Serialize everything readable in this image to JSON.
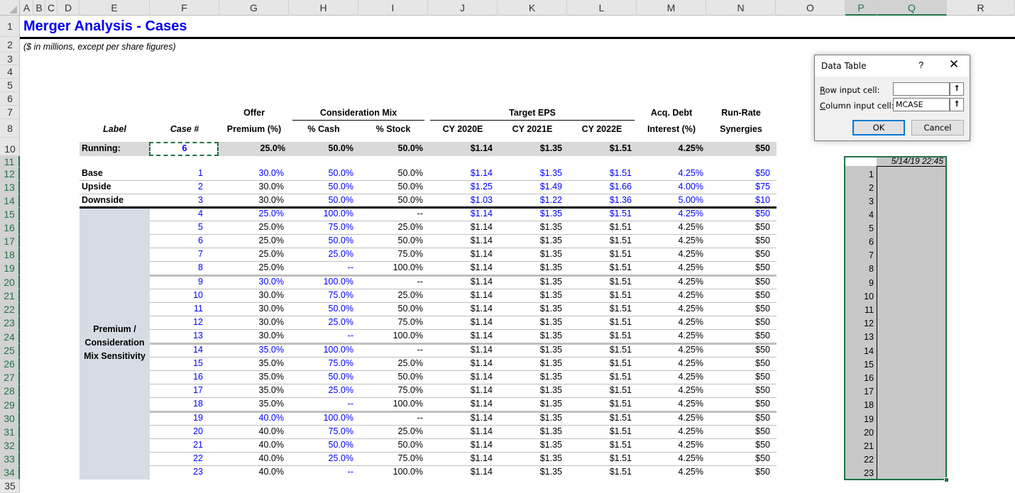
{
  "sheet": {
    "column_headers": [
      "A",
      "B",
      "C",
      "D",
      "E",
      "F",
      "G",
      "H",
      "I",
      "J",
      "K",
      "L",
      "M",
      "N",
      "O",
      "P",
      "Q",
      "R"
    ],
    "row_headers": [
      "1",
      "2",
      "3",
      "4",
      "5",
      "6",
      "7",
      "8",
      "10",
      "11",
      "12",
      "13",
      "14",
      "15",
      "16",
      "17",
      "18",
      "19",
      "20",
      "21",
      "22",
      "23",
      "24",
      "25",
      "26",
      "27",
      "28",
      "29",
      "30",
      "31",
      "32",
      "33",
      "34",
      "35"
    ],
    "title": "Merger Analysis - Cases",
    "subtitle": "($ in millions, except per share figures)"
  },
  "headers": {
    "label": "Label",
    "case": "Case #",
    "offer_top": "Offer",
    "offer_bottom": "Premium (%)",
    "consideration_group": "Consideration Mix",
    "cash": "% Cash",
    "stock": "% Stock",
    "eps_group": "Target EPS",
    "cy2020": "CY 2020E",
    "cy2021": "CY 2021E",
    "cy2022": "CY 2022E",
    "debt_top": "Acq. Debt",
    "debt_bottom": "Interest (%)",
    "syn_top": "Run-Rate",
    "syn_bottom": "Synergies"
  },
  "running": {
    "label": "Running:",
    "case": "6",
    "premium": "25.0%",
    "cash": "50.0%",
    "stock": "50.0%",
    "eps2020": "$1.14",
    "eps2021": "$1.35",
    "eps2022": "$1.51",
    "debt": "4.25%",
    "synergies": "$50"
  },
  "sensitivity_label": [
    "Premium /",
    "Consideration",
    "Mix Sensitivity"
  ],
  "cases": [
    {
      "label": "Base",
      "case": "1",
      "premium": "30.0%",
      "cash": "50.0%",
      "stock": "50.0%",
      "eps2020": "$1.14",
      "eps2021": "$1.35",
      "eps2022": "$1.51",
      "debt": "4.25%",
      "synergies": "$50"
    },
    {
      "label": "Upside",
      "case": "2",
      "premium": "30.0%",
      "cash": "50.0%",
      "stock": "50.0%",
      "eps2020": "$1.25",
      "eps2021": "$1.49",
      "eps2022": "$1.66",
      "debt": "4.00%",
      "synergies": "$75"
    },
    {
      "label": "Downside",
      "case": "3",
      "premium": "30.0%",
      "cash": "50.0%",
      "stock": "50.0%",
      "eps2020": "$1.03",
      "eps2021": "$1.22",
      "eps2022": "$1.36",
      "debt": "5.00%",
      "synergies": "$10"
    },
    {
      "label": "",
      "case": "4",
      "premium": "25.0%",
      "cash": "100.0%",
      "stock": "--",
      "eps2020": "$1.14",
      "eps2021": "$1.35",
      "eps2022": "$1.51",
      "debt": "4.25%",
      "synergies": "$50"
    },
    {
      "label": "",
      "case": "5",
      "premium": "25.0%",
      "cash": "75.0%",
      "stock": "25.0%",
      "eps2020": "$1.14",
      "eps2021": "$1.35",
      "eps2022": "$1.51",
      "debt": "4.25%",
      "synergies": "$50"
    },
    {
      "label": "",
      "case": "6",
      "premium": "25.0%",
      "cash": "50.0%",
      "stock": "50.0%",
      "eps2020": "$1.14",
      "eps2021": "$1.35",
      "eps2022": "$1.51",
      "debt": "4.25%",
      "synergies": "$50"
    },
    {
      "label": "",
      "case": "7",
      "premium": "25.0%",
      "cash": "25.0%",
      "stock": "75.0%",
      "eps2020": "$1.14",
      "eps2021": "$1.35",
      "eps2022": "$1.51",
      "debt": "4.25%",
      "synergies": "$50"
    },
    {
      "label": "",
      "case": "8",
      "premium": "25.0%",
      "cash": "--",
      "stock": "100.0%",
      "eps2020": "$1.14",
      "eps2021": "$1.35",
      "eps2022": "$1.51",
      "debt": "4.25%",
      "synergies": "$50"
    },
    {
      "label": "",
      "case": "9",
      "premium": "30.0%",
      "cash": "100.0%",
      "stock": "--",
      "eps2020": "$1.14",
      "eps2021": "$1.35",
      "eps2022": "$1.51",
      "debt": "4.25%",
      "synergies": "$50"
    },
    {
      "label": "",
      "case": "10",
      "premium": "30.0%",
      "cash": "75.0%",
      "stock": "25.0%",
      "eps2020": "$1.14",
      "eps2021": "$1.35",
      "eps2022": "$1.51",
      "debt": "4.25%",
      "synergies": "$50"
    },
    {
      "label": "",
      "case": "11",
      "premium": "30.0%",
      "cash": "50.0%",
      "stock": "50.0%",
      "eps2020": "$1.14",
      "eps2021": "$1.35",
      "eps2022": "$1.51",
      "debt": "4.25%",
      "synergies": "$50"
    },
    {
      "label": "",
      "case": "12",
      "premium": "30.0%",
      "cash": "25.0%",
      "stock": "75.0%",
      "eps2020": "$1.14",
      "eps2021": "$1.35",
      "eps2022": "$1.51",
      "debt": "4.25%",
      "synergies": "$50"
    },
    {
      "label": "",
      "case": "13",
      "premium": "30.0%",
      "cash": "--",
      "stock": "100.0%",
      "eps2020": "$1.14",
      "eps2021": "$1.35",
      "eps2022": "$1.51",
      "debt": "4.25%",
      "synergies": "$50"
    },
    {
      "label": "",
      "case": "14",
      "premium": "35.0%",
      "cash": "100.0%",
      "stock": "--",
      "eps2020": "$1.14",
      "eps2021": "$1.35",
      "eps2022": "$1.51",
      "debt": "4.25%",
      "synergies": "$50"
    },
    {
      "label": "",
      "case": "15",
      "premium": "35.0%",
      "cash": "75.0%",
      "stock": "25.0%",
      "eps2020": "$1.14",
      "eps2021": "$1.35",
      "eps2022": "$1.51",
      "debt": "4.25%",
      "synergies": "$50"
    },
    {
      "label": "",
      "case": "16",
      "premium": "35.0%",
      "cash": "50.0%",
      "stock": "50.0%",
      "eps2020": "$1.14",
      "eps2021": "$1.35",
      "eps2022": "$1.51",
      "debt": "4.25%",
      "synergies": "$50"
    },
    {
      "label": "",
      "case": "17",
      "premium": "35.0%",
      "cash": "25.0%",
      "stock": "75.0%",
      "eps2020": "$1.14",
      "eps2021": "$1.35",
      "eps2022": "$1.51",
      "debt": "4.25%",
      "synergies": "$50"
    },
    {
      "label": "",
      "case": "18",
      "premium": "35.0%",
      "cash": "--",
      "stock": "100.0%",
      "eps2020": "$1.14",
      "eps2021": "$1.35",
      "eps2022": "$1.51",
      "debt": "4.25%",
      "synergies": "$50"
    },
    {
      "label": "",
      "case": "19",
      "premium": "40.0%",
      "cash": "100.0%",
      "stock": "--",
      "eps2020": "$1.14",
      "eps2021": "$1.35",
      "eps2022": "$1.51",
      "debt": "4.25%",
      "synergies": "$50"
    },
    {
      "label": "",
      "case": "20",
      "premium": "40.0%",
      "cash": "75.0%",
      "stock": "25.0%",
      "eps2020": "$1.14",
      "eps2021": "$1.35",
      "eps2022": "$1.51",
      "debt": "4.25%",
      "synergies": "$50"
    },
    {
      "label": "",
      "case": "21",
      "premium": "40.0%",
      "cash": "50.0%",
      "stock": "50.0%",
      "eps2020": "$1.14",
      "eps2021": "$1.35",
      "eps2022": "$1.51",
      "debt": "4.25%",
      "synergies": "$50"
    },
    {
      "label": "",
      "case": "22",
      "premium": "40.0%",
      "cash": "25.0%",
      "stock": "75.0%",
      "eps2020": "$1.14",
      "eps2021": "$1.35",
      "eps2022": "$1.51",
      "debt": "4.25%",
      "synergies": "$50"
    },
    {
      "label": "",
      "case": "23",
      "premium": "40.0%",
      "cash": "--",
      "stock": "100.0%",
      "eps2020": "$1.14",
      "eps2021": "$1.35",
      "eps2022": "$1.51",
      "debt": "4.25%",
      "synergies": "$50"
    }
  ],
  "data_table": {
    "timestamp": "5/14/19 22:45",
    "row_numbers": [
      "1",
      "2",
      "3",
      "4",
      "5",
      "6",
      "7",
      "8",
      "9",
      "10",
      "11",
      "12",
      "13",
      "14",
      "15",
      "16",
      "17",
      "18",
      "19",
      "20",
      "21",
      "22",
      "23"
    ]
  },
  "dialog": {
    "title": "Data Table",
    "help": "?",
    "close": "✕",
    "row_input_label_key": "R",
    "row_input_label_rest": "ow input cell:",
    "row_input_value": "",
    "column_input_label_key": "C",
    "column_input_label_rest": "olumn input cell:",
    "column_input_value": "MCASE",
    "picker_glyph": "⭡",
    "ok_label": "OK",
    "cancel_label": "Cancel"
  },
  "colors": {
    "title": "#0000ee",
    "input_blue": "#0000ff",
    "excel_green": "#217346",
    "running_band": "#d9d9d9",
    "sensitivity_band": "#d6dce4",
    "data_table_fill": "#c8c8c8"
  }
}
